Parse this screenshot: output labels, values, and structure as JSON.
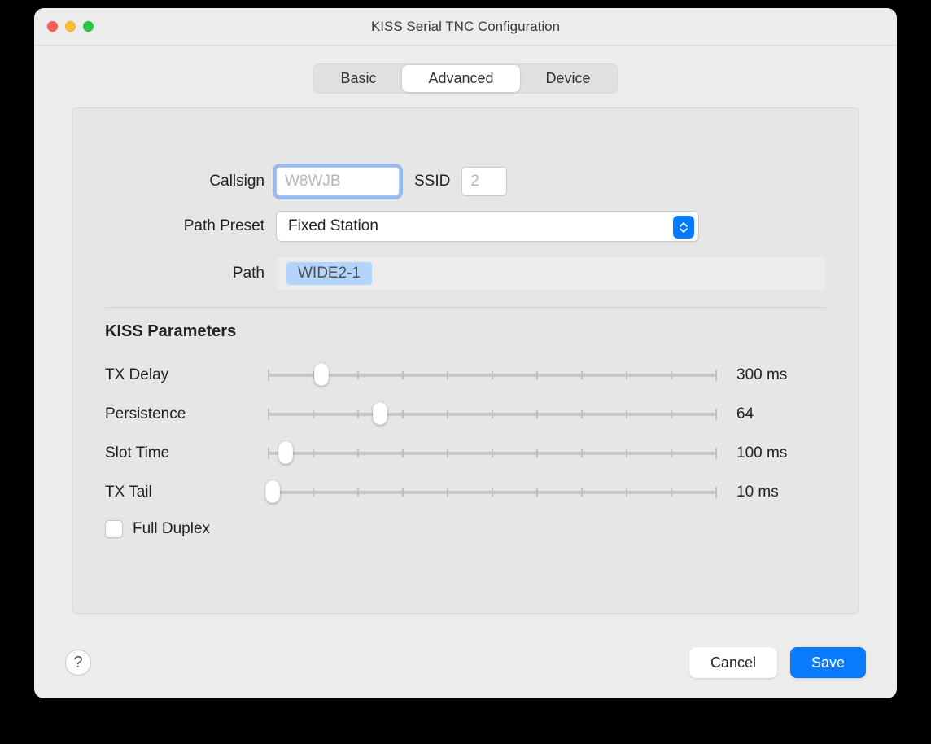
{
  "title": "KISS Serial TNC Configuration",
  "tabs": {
    "basic": "Basic",
    "advanced": "Advanced",
    "device": "Device",
    "active": "advanced"
  },
  "form": {
    "callsign_label": "Callsign",
    "callsign_placeholder": "W8WJB",
    "callsign_value": "",
    "ssid_label": "SSID",
    "ssid_placeholder": "2",
    "ssid_value": "",
    "path_preset_label": "Path Preset",
    "path_preset_value": "Fixed Station",
    "path_label": "Path",
    "path_tag": "WIDE2-1"
  },
  "kiss": {
    "title": "KISS Parameters",
    "tx_delay": {
      "label": "TX Delay",
      "display": "300 ms",
      "percent": 12
    },
    "persistence": {
      "label": "Persistence",
      "display": "64",
      "percent": 25
    },
    "slot_time": {
      "label": "Slot Time",
      "display": "100 ms",
      "percent": 4
    },
    "tx_tail": {
      "label": "TX Tail",
      "display": "10 ms",
      "percent": 1
    },
    "full_duplex_label": "Full Duplex",
    "full_duplex_checked": false
  },
  "footer": {
    "help": "?",
    "cancel": "Cancel",
    "save": "Save"
  }
}
